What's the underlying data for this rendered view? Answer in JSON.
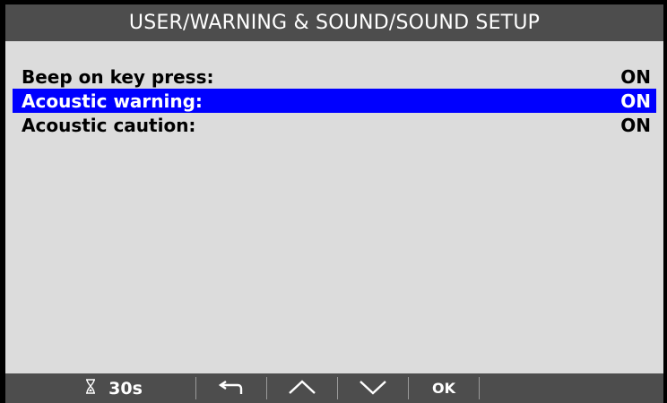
{
  "title": "USER/WARNING & SOUND/SOUND SETUP",
  "settings": [
    {
      "label": "Beep on key press:",
      "value": "ON",
      "selected": false
    },
    {
      "label": "Acoustic warning:",
      "value": "ON",
      "selected": true
    },
    {
      "label": "Acoustic caution:",
      "value": "ON",
      "selected": false
    }
  ],
  "bottom_bar": {
    "timer_icon": "hourglass-icon",
    "timer": "30s",
    "back_icon": "back-arrow-icon",
    "up_icon": "chevron-up-icon",
    "down_icon": "chevron-down-icon",
    "ok_label": "OK"
  },
  "colors": {
    "title_bar": "#4d4d4d",
    "screen_bg": "#dcdcdc",
    "selection": "#0000ff"
  }
}
